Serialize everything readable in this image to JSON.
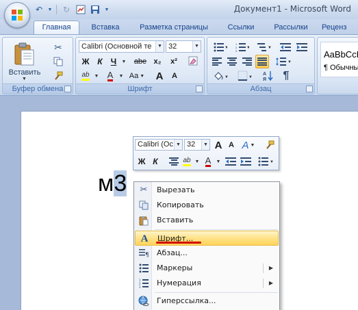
{
  "window": {
    "title": "Документ1 - Microsoft Word"
  },
  "tabs": [
    {
      "label": "Главная",
      "active": true
    },
    {
      "label": "Вставка"
    },
    {
      "label": "Разметка страницы"
    },
    {
      "label": "Ссылки"
    },
    {
      "label": "Рассылки"
    },
    {
      "label": "Реценз"
    }
  ],
  "ribbon": {
    "clipboard": {
      "label": "Буфер обмена",
      "paste_label": "Вставить"
    },
    "font": {
      "label": "Шрифт",
      "font_name": "Calibri (Основной те",
      "font_size": "32",
      "bold": "Ж",
      "italic": "К",
      "underline": "Ч",
      "strike": "abe",
      "sub": "x₂",
      "sup": "x²",
      "grow": "A",
      "shrink": "A",
      "case": "Aa",
      "highlight": "ab",
      "fontcolor": "A"
    },
    "paragraph": {
      "label": "Абзац",
      "pilcrow": "¶"
    },
    "styles": {
      "preview": "AaBbCcD",
      "name": "¶ Обычны"
    }
  },
  "document": {
    "text_before": "м",
    "text_selected": "3"
  },
  "mini_toolbar": {
    "font_name": "Calibri (Ос",
    "font_size": "32",
    "grow": "A",
    "shrink": "A",
    "styles": "A",
    "bold": "Ж",
    "italic": "К",
    "highlight": "ab",
    "fontcolor": "A"
  },
  "context_menu": {
    "cut": "Вырезать",
    "copy": "Копировать",
    "paste": "Вставить",
    "font": "Шрифт...",
    "paragraph": "Абзац...",
    "bullets": "Маркеры",
    "numbering": "Нумерация",
    "hyperlink": "Гиперссылка..."
  },
  "colors": {
    "accent_red": "#d10000",
    "highlight_yellow": "#ffff00",
    "menu_highlight": "#ffe38a"
  }
}
